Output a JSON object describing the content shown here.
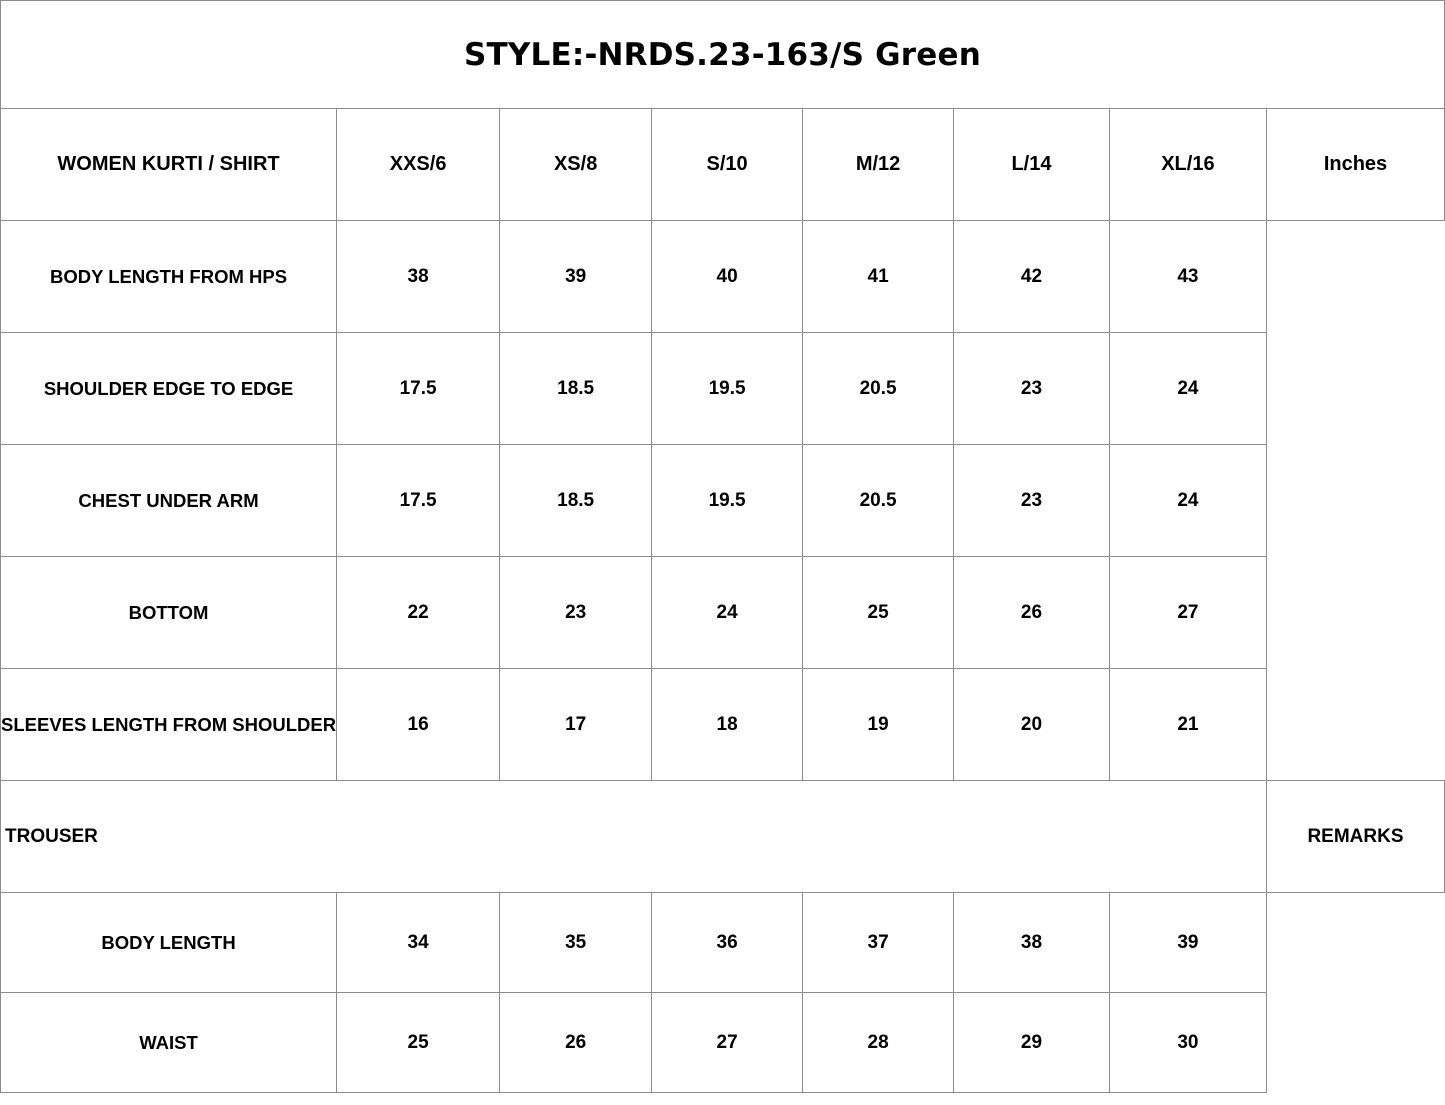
{
  "title": "STYLE:-NRDS.23-163/S Green",
  "header": {
    "label": "WOMEN KURTI / SHIRT",
    "sizes": [
      "XXS/6",
      "XS/8",
      "S/10",
      "M/12",
      "L/14",
      "XL/16"
    ],
    "unit": "Inches"
  },
  "kurti_rows": [
    {
      "label": "BODY LENGTH FROM HPS",
      "values": [
        "38",
        "39",
        "40",
        "41",
        "42",
        "43"
      ]
    },
    {
      "label": "SHOULDER EDGE TO EDGE",
      "values": [
        "17.5",
        "18.5",
        "19.5",
        "20.5",
        "23",
        "24"
      ]
    },
    {
      "label": "CHEST UNDER ARM",
      "values": [
        "17.5",
        "18.5",
        "19.5",
        "20.5",
        "23",
        "24"
      ]
    },
    {
      "label": "BOTTOM",
      "values": [
        "22",
        "23",
        "24",
        "25",
        "26",
        "27"
      ]
    },
    {
      "label": "SLEEVES LENGTH FROM SHOULDER",
      "values": [
        "16",
        "17",
        "18",
        "19",
        "20",
        "21"
      ]
    }
  ],
  "trouser_section": {
    "label": "TROUSER",
    "remarks": "REMARKS"
  },
  "trouser_rows": [
    {
      "label": "BODY LENGTH",
      "values": [
        "34",
        "35",
        "36",
        "37",
        "38",
        "39"
      ]
    },
    {
      "label": "WAIST",
      "values": [
        "25",
        "26",
        "27",
        "28",
        "29",
        "30"
      ]
    }
  ]
}
